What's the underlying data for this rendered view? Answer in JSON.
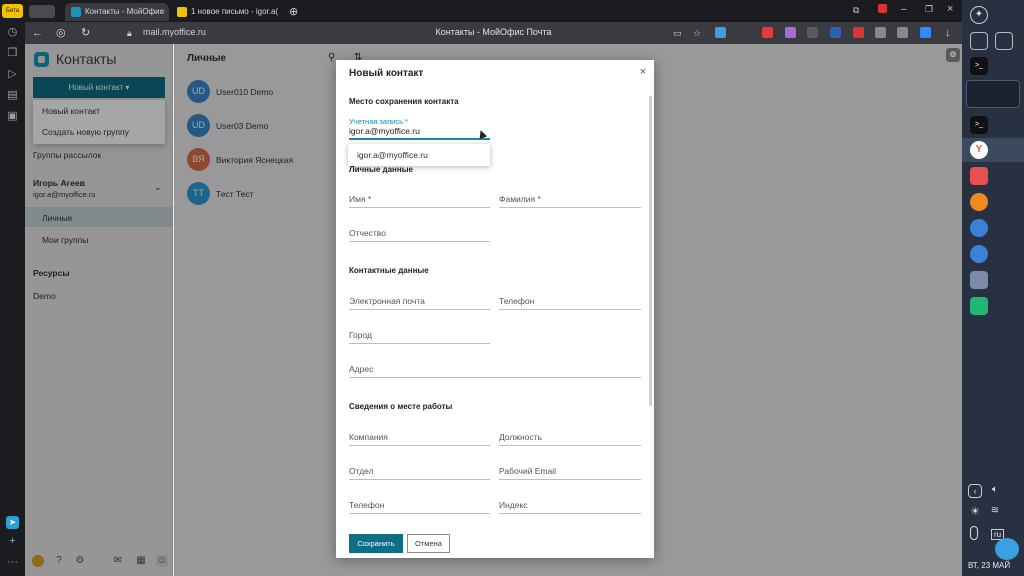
{
  "browser": {
    "tabs": [
      {
        "label": "Контакты - МойОфис",
        "active": true
      },
      {
        "label": "1 новое письмо - igor.a(",
        "active": false
      }
    ],
    "url": "mail.myoffice.ru",
    "page_title": "Контакты - МойОфис Почта",
    "left_badge": "Бета"
  },
  "sidebar": {
    "app_title": "Контакты",
    "new_button": "Новый контакт ▾",
    "dropdown": [
      "Новый контакт",
      "Создать новую группу"
    ],
    "mailing_groups": "Группы рассылок",
    "user_name": "Игорь Агеев",
    "user_email": "igor.a@myoffice.ru",
    "personal": "Личные",
    "my_groups": "Мои группы",
    "resources": "Ресурсы",
    "demo": "Demo"
  },
  "list": {
    "title": "Личные",
    "contacts": [
      {
        "initials": "UD",
        "name": "User010 Demo",
        "color": "#3a89c9"
      },
      {
        "initials": "UD",
        "name": "User03 Demo",
        "color": "#3a89c9"
      },
      {
        "initials": "ВЯ",
        "name": "Виктория Яснецкая",
        "color": "#d9704a"
      },
      {
        "initials": "TT",
        "name": "Тест Тест",
        "color": "#2f9bd6"
      }
    ]
  },
  "modal": {
    "title": "Новый контакт",
    "close": "×",
    "storage_section": "Место сохранения контакта",
    "account_label": "Учетная запись *",
    "account_value": "igor.a@myoffice.ru",
    "account_option": "igor.a@myoffice.ru",
    "personal_section": "Личные данные",
    "first_name": "Имя *",
    "last_name": "Фамилия *",
    "patronymic": "Отчество",
    "contact_section": "Контактные данные",
    "email": "Электронная почта",
    "phone": "Телефон",
    "city": "Город",
    "address": "Адрес",
    "work_section": "Сведения о месте работы",
    "company": "Компания",
    "position": "Должность",
    "department": "Отдел",
    "work_email": "Рабочий Email",
    "work_phone": "Телефон",
    "postal_code": "Индекс",
    "save": "Сохранить",
    "cancel": "Отмена"
  },
  "dock": {
    "lang": "ru",
    "date": "ВТ, 23 МАЙ"
  }
}
